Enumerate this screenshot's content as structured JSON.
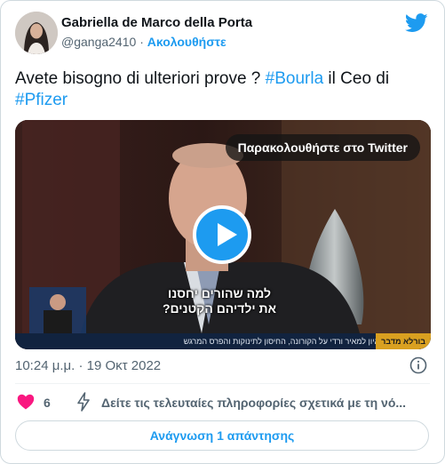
{
  "author": {
    "name": "Gabriella de Marco della Porta",
    "handle": "@ganga2410",
    "separator": "·",
    "follow_label": "Ακολουθήστε"
  },
  "tweet": {
    "text_1": "Avete bisogno di ulteriori prove ? ",
    "hashtag_1": "#Bourla",
    "text_2": " il Ceo di ",
    "hashtag_2": "#Pfizer"
  },
  "media": {
    "watch_label": "Παρακολουθήστε στο Twitter",
    "subtitle_line_1": "למה שהורים יחסנו",
    "subtitle_line_2": "את ילדיהם הקטנים?",
    "ticker_text": "מנכ\"ל פייזר בריאיון למאיר ורדי על הקורונה, החיסון לתינוקות והפרס המרגש",
    "ticker_tag": "בורלא מדבר"
  },
  "meta": {
    "timestamp": "10:24 μ.μ. · 19 Οκτ 2022"
  },
  "actions": {
    "like_count": "6",
    "info_link": "Δείτε τις τελευταίες πληροφορίες σχετικά με τη νό...",
    "reply_label": "Ανάγνωση 1 απάντησης"
  },
  "colors": {
    "accent": "#1d9bf0",
    "like": "#f91880",
    "text_secondary": "#536471"
  },
  "icons": [
    "twitter-logo-icon",
    "play-icon",
    "info-icon",
    "heart-icon",
    "bolt-icon"
  ]
}
